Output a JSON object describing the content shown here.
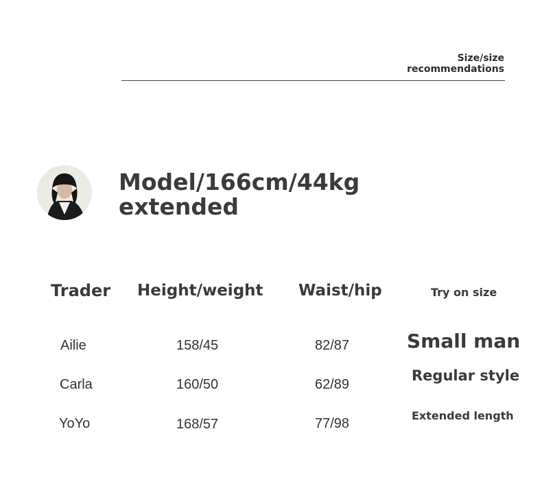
{
  "section": {
    "title_line1": "Size/size",
    "title_line2": "recommendations"
  },
  "model": {
    "line1": "Model/166cm/44kg",
    "line2": "extended",
    "avatar_icon": "model-portrait"
  },
  "table": {
    "headers": [
      "Trader",
      "Height/weight",
      "Waist/hip",
      "Try on size"
    ],
    "rows": [
      {
        "trader": "Ailie",
        "height_weight": "158/45",
        "waist_hip": "82/87"
      },
      {
        "trader": "Carla",
        "height_weight": "160/50",
        "waist_hip": "62/89"
      },
      {
        "trader": "YoYo",
        "height_weight": "168/57",
        "waist_hip": "77/98"
      }
    ],
    "try_on_sizes": [
      "Small man",
      "Regular style",
      "Extended length"
    ]
  }
}
